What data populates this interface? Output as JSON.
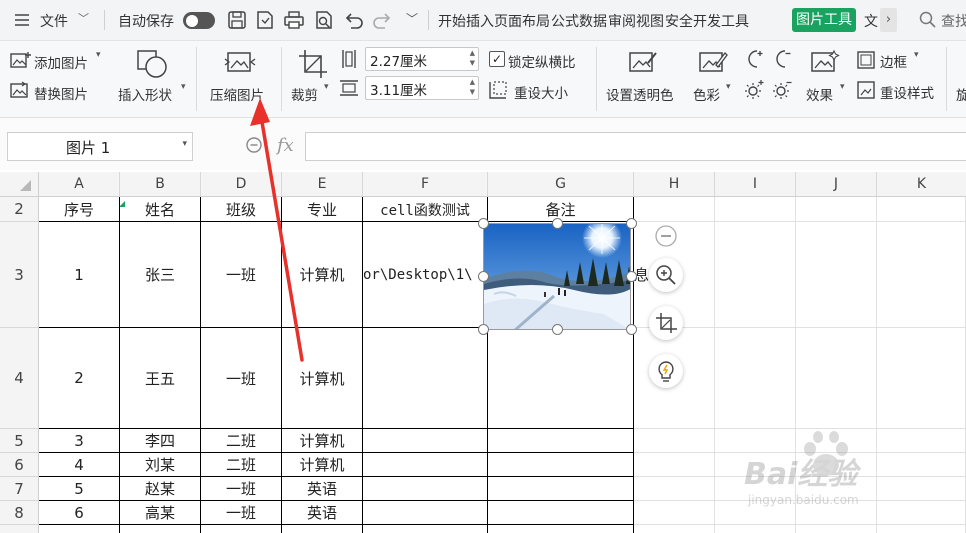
{
  "menubar": {
    "file_label": "文件",
    "autosave_label": "自动保存",
    "tabs": [
      "开始",
      "插入",
      "页面布局",
      "公式",
      "数据",
      "审阅",
      "视图",
      "安全",
      "开发工具"
    ],
    "active_tool_tab": "图片工具",
    "truncated_tab": "文",
    "search_label": "查找"
  },
  "ribbon": {
    "add_picture": "添加图片",
    "replace_picture": "替换图片",
    "insert_shape": "插入形状",
    "compress_picture": "压缩图片",
    "crop": "裁剪",
    "width_value": "2.27厘米",
    "height_value": "3.11厘米",
    "lock_ratio": "锁定纵横比",
    "reset_size": "重设大小",
    "set_transparent": "设置透明色",
    "color": "色彩",
    "effects": "效果",
    "border": "边框",
    "reset_style": "重设样式",
    "truncated": "旋"
  },
  "formula": {
    "name_box": "图片 1",
    "fx": "fx"
  },
  "columns": [
    "A",
    "B",
    "D",
    "E",
    "F",
    "G",
    "H",
    "I",
    "J",
    "K"
  ],
  "row_numbers": [
    "2",
    "3",
    "4",
    "5",
    "6",
    "7",
    "8"
  ],
  "table": {
    "headers": [
      "序号",
      "姓名",
      "班级",
      "专业",
      "cell函数测试",
      "备注"
    ],
    "rows": [
      [
        "1",
        "张三",
        "一班",
        "计算机",
        "or\\Desktop\\1\\",
        ""
      ],
      [
        "2",
        "王五",
        "一班",
        "计算机",
        "",
        ""
      ],
      [
        "3",
        "李四",
        "二班",
        "计算机",
        "",
        ""
      ],
      [
        "4",
        "刘某",
        "二班",
        "计算机",
        "",
        ""
      ],
      [
        "5",
        "赵某",
        "一班",
        "英语",
        "",
        ""
      ],
      [
        "6",
        "高某",
        "一班",
        "英语",
        "",
        ""
      ]
    ],
    "overflow_text": "息"
  },
  "watermark": {
    "brand": "Bai经验",
    "url": "jingyan.baidu.com"
  },
  "colors": {
    "accent_green": "#1aa260",
    "arrow_red": "#e8312a",
    "header_bg": "#f4f4f4"
  }
}
